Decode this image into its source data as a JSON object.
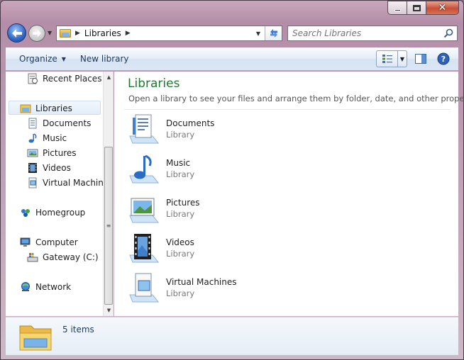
{
  "window": {
    "caption_buttons": [
      "minimize",
      "maximize",
      "close"
    ]
  },
  "navigation": {
    "address_segments": [
      "Libraries"
    ],
    "search_placeholder": "Search Libraries"
  },
  "toolbar": {
    "organize_label": "Organize",
    "new_library_label": "New library"
  },
  "sidebar": {
    "items": [
      {
        "label": "Recent Places",
        "icon": "recent-places-icon"
      },
      {
        "label": "Libraries",
        "icon": "libraries-icon",
        "selected": true
      },
      {
        "label": "Documents",
        "icon": "documents-icon"
      },
      {
        "label": "Music",
        "icon": "music-icon"
      },
      {
        "label": "Pictures",
        "icon": "pictures-icon"
      },
      {
        "label": "Videos",
        "icon": "videos-icon"
      },
      {
        "label": "Virtual Machine",
        "icon": "virtual-machine-icon"
      },
      {
        "label": "Homegroup",
        "icon": "homegroup-icon"
      },
      {
        "label": "Computer",
        "icon": "computer-icon"
      },
      {
        "label": "Gateway (C:)",
        "icon": "drive-icon"
      },
      {
        "label": "Network",
        "icon": "network-icon"
      }
    ]
  },
  "main": {
    "title": "Libraries",
    "subtitle": "Open a library to see your files and arrange them by folder, date, and other prope...",
    "libraries": [
      {
        "name": "Documents",
        "type": "Library",
        "icon": "documents-library-icon"
      },
      {
        "name": "Music",
        "type": "Library",
        "icon": "music-library-icon"
      },
      {
        "name": "Pictures",
        "type": "Library",
        "icon": "pictures-library-icon"
      },
      {
        "name": "Videos",
        "type": "Library",
        "icon": "videos-library-icon"
      },
      {
        "name": "Virtual Machines",
        "type": "Library",
        "icon": "virtual-machines-library-icon"
      }
    ]
  },
  "details": {
    "item_count": "5 items"
  },
  "colors": {
    "title_green": "#1e7a2e",
    "command_text": "#1e395b",
    "close_button": "#c74f36"
  }
}
